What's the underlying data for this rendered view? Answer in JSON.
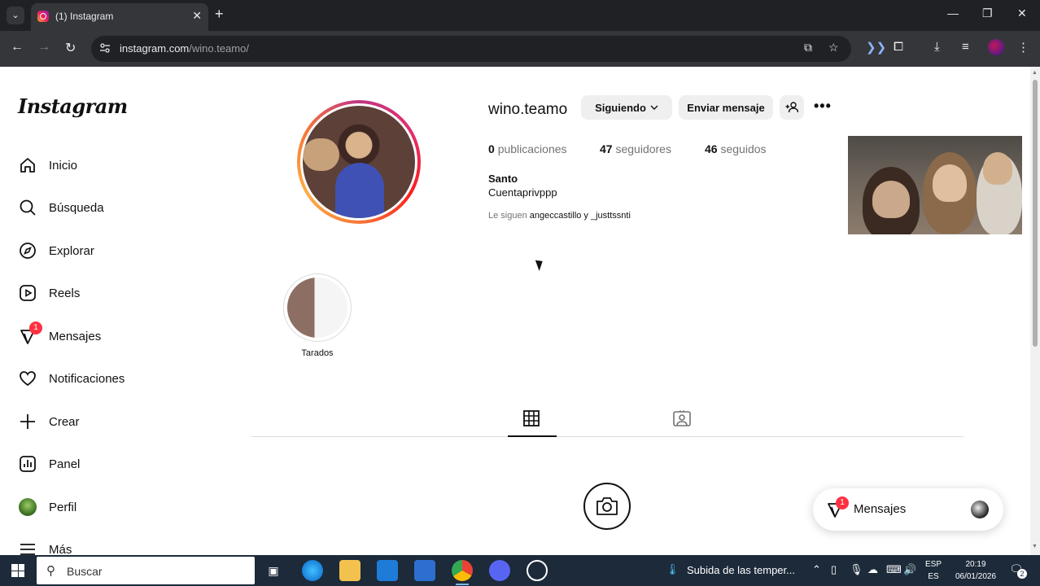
{
  "browser": {
    "tab_title": "(1) Instagram",
    "url_host": "instagram.com",
    "url_path": "/wino.teamo/",
    "tab_menu_icon": "chevron-down-icon",
    "close_glyph": "✕",
    "new_tab_glyph": "+"
  },
  "sidebar": {
    "logo": "Instagram",
    "items": [
      {
        "label": "Inicio",
        "icon": "home-icon"
      },
      {
        "label": "Búsqueda",
        "icon": "search-icon"
      },
      {
        "label": "Explorar",
        "icon": "compass-icon"
      },
      {
        "label": "Reels",
        "icon": "reels-icon"
      },
      {
        "label": "Mensajes",
        "icon": "messenger-icon",
        "badge": "1"
      },
      {
        "label": "Notificaciones",
        "icon": "heart-icon"
      },
      {
        "label": "Crear",
        "icon": "plus-icon"
      },
      {
        "label": "Panel",
        "icon": "chart-icon"
      },
      {
        "label": "Perfil",
        "icon": "avatar"
      },
      {
        "label": "Más",
        "icon": "menu-icon"
      }
    ]
  },
  "profile": {
    "username": "wino.teamo",
    "following_button": "Siguiendo",
    "message_button": "Enviar mensaje",
    "stats": {
      "posts_count": "0",
      "posts_label": "publicaciones",
      "followers_count": "47",
      "followers_label": "seguidores",
      "following_count": "46",
      "following_label": "seguidos"
    },
    "full_name": "Santo",
    "bio": "Cuentaprivppp",
    "followed_by_prefix": "Le siguen",
    "followed_by_names": "angeccastillo y _justtssnti"
  },
  "highlights": [
    {
      "label": "Tarados"
    }
  ],
  "messages_widget": {
    "label": "Mensajes",
    "badge": "1"
  },
  "taskbar": {
    "search_label": "Buscar",
    "weather_text": "Subida de las temper...",
    "lang_top": "ESP",
    "lang_bottom": "ES",
    "time": "20:19",
    "date": "06/01/2026",
    "notification_count": "2"
  },
  "colors": {
    "badge": "#ff3040",
    "button_bg": "#efefef",
    "taskbar": "#1c2a3a",
    "chrome_dark": "#202124"
  }
}
